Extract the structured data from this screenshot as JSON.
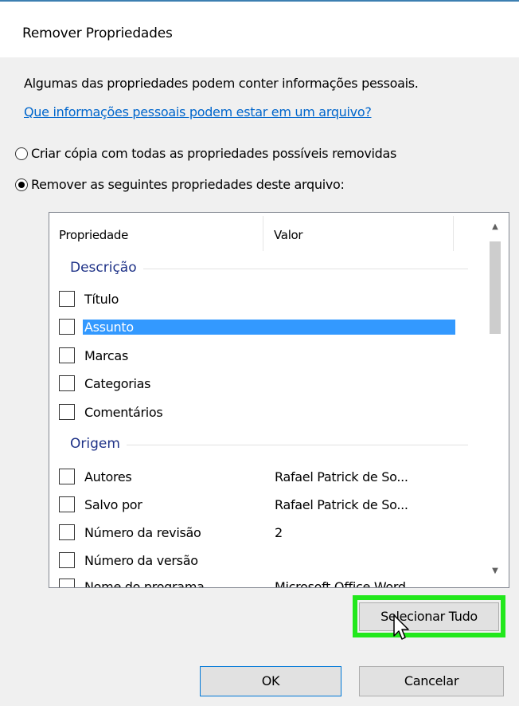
{
  "window": {
    "title": "Remover Propriedades"
  },
  "info": {
    "text": "Algumas das propriedades podem conter informações pessoais.",
    "link": "Que informações pessoais podem estar em um arquivo?"
  },
  "options": [
    {
      "label": "Criar cópia com todas as propriedades possíveis removidas",
      "checked": false
    },
    {
      "label": "Remover as seguintes propriedades deste arquivo:",
      "checked": true
    }
  ],
  "list": {
    "columns": {
      "property": "Propriedade",
      "value": "Valor"
    },
    "groups": [
      {
        "name": "Descrição",
        "items": [
          {
            "name": "Título",
            "value": ""
          },
          {
            "name": "Assunto",
            "value": "",
            "selected": true
          },
          {
            "name": "Marcas",
            "value": ""
          },
          {
            "name": "Categorias",
            "value": ""
          },
          {
            "name": "Comentários",
            "value": ""
          }
        ]
      },
      {
        "name": "Origem",
        "items": [
          {
            "name": "Autores",
            "value": "Rafael Patrick de So..."
          },
          {
            "name": "Salvo por",
            "value": "Rafael Patrick de So..."
          },
          {
            "name": "Número da revisão",
            "value": "2"
          },
          {
            "name": "Número da versão",
            "value": ""
          },
          {
            "name": "Nome do programa",
            "value": "Microsoft Office Word"
          }
        ]
      }
    ]
  },
  "buttons": {
    "select_all": "Selecionar Tudo",
    "ok": "OK",
    "cancel": "Cancelar"
  },
  "colors": {
    "highlight": "#22e81c",
    "selection": "#3399ff",
    "link": "#0066cc"
  }
}
